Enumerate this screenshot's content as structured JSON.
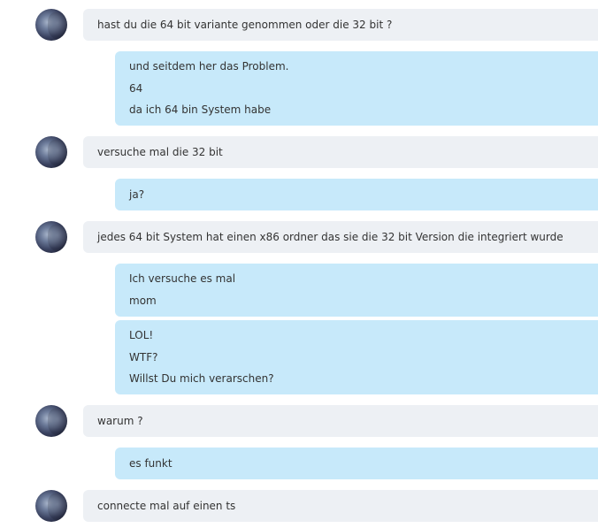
{
  "messages": [
    {
      "sender": "them",
      "lines": [
        "hast du die 64 bit variante genommen oder die 32 bit ?"
      ]
    },
    {
      "sender": "me",
      "lines": [
        "und seitdem her das Problem.",
        "64",
        "da ich 64 bin System habe"
      ]
    },
    {
      "sender": "them",
      "lines": [
        "versuche mal die 32 bit"
      ]
    },
    {
      "sender": "me",
      "lines": [
        "ja?"
      ]
    },
    {
      "sender": "them",
      "lines": [
        "jedes 64 bit System hat einen x86 ordner das sie die 32 bit Version die integriert wurde"
      ]
    },
    {
      "sender": "me",
      "lines": [
        "Ich versuche es mal",
        "mom"
      ]
    },
    {
      "sender": "me",
      "lines": [
        "LOL!",
        "WTF?",
        "Willst Du mich verarschen?"
      ]
    },
    {
      "sender": "them",
      "lines": [
        "warum ?"
      ]
    },
    {
      "sender": "me",
      "lines": [
        "es funkt"
      ]
    },
    {
      "sender": "them",
      "lines": [
        "connecte mal auf einen ts"
      ]
    }
  ]
}
